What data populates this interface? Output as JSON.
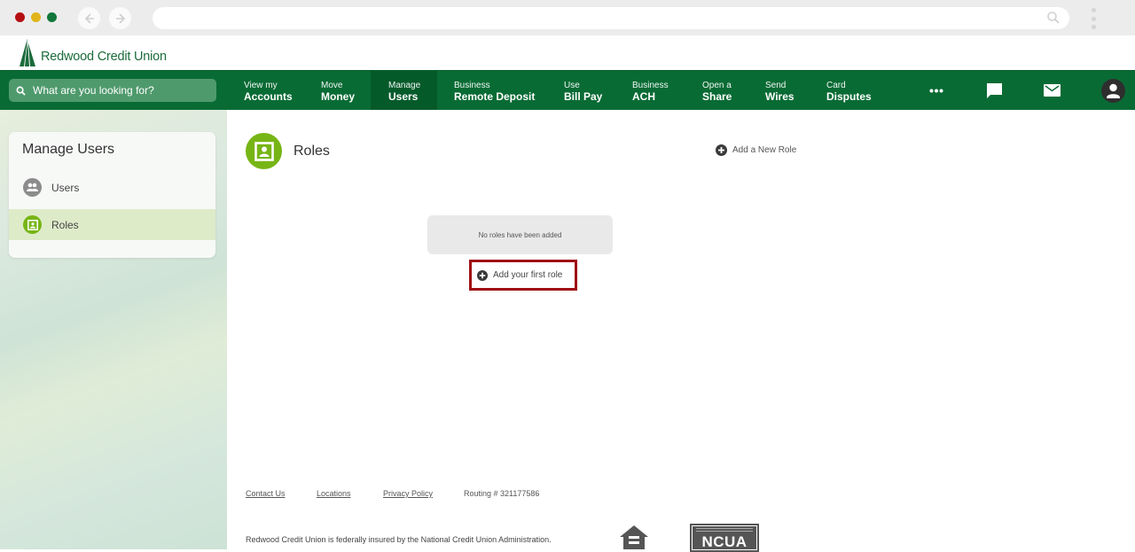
{
  "browser": {
    "url_value": "",
    "back_icon": "arrow-left-icon",
    "forward_icon": "arrow-right-icon",
    "search_icon": "search-icon",
    "menu_icon": "kebab-icon"
  },
  "brand": {
    "name": "Redwood Credit Union",
    "color": "#096b34",
    "accent": "#77b516"
  },
  "topnav": {
    "search_placeholder": "What are you looking for?",
    "items": [
      {
        "line1": "View my",
        "line2": "Accounts"
      },
      {
        "line1": "Move",
        "line2": "Money"
      },
      {
        "line1": "Manage",
        "line2": "Users",
        "active": true
      },
      {
        "line1": "Business",
        "line2": "Remote Deposit"
      },
      {
        "line1": "Use",
        "line2": "Bill Pay"
      },
      {
        "line1": "Business",
        "line2": "ACH"
      },
      {
        "line1": "Open a",
        "line2": "Share"
      },
      {
        "line1": "Send",
        "line2": "Wires"
      },
      {
        "line1": "Card",
        "line2": "Disputes"
      }
    ],
    "icons": [
      "more-icon",
      "chat-icon",
      "mail-icon",
      "profile-icon"
    ]
  },
  "sidebar": {
    "title": "Manage Users",
    "items": [
      {
        "label": "Users",
        "icon": "users-icon",
        "selected": false
      },
      {
        "label": "Roles",
        "icon": "role-badge-icon",
        "selected": true
      }
    ]
  },
  "main": {
    "title": "Roles",
    "add_new_label": "Add a New Role",
    "empty_message": "No roles have been added",
    "add_first_label": "Add your first role"
  },
  "footer": {
    "links": [
      "Contact Us",
      "Locations",
      "Privacy Policy"
    ],
    "routing": "Routing # 321177586",
    "insured_text": "Redwood Credit Union is federally insured by the National Credit Union Administration.",
    "ncua_label": "NCUA"
  }
}
